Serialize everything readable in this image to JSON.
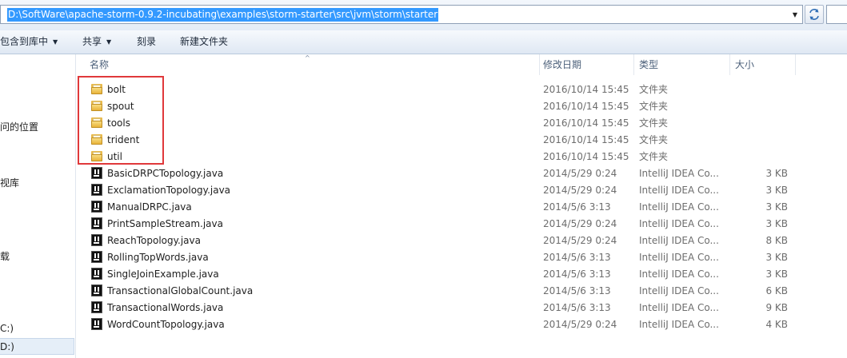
{
  "address_bar": {
    "path": "D:\\SoftWare\\apache-storm-0.9.2-incubating\\examples\\storm-starter\\src\\jvm\\storm\\starter",
    "dropdown_icon": "chevron-down-icon",
    "refresh_icon": "refresh-icon"
  },
  "toolbar": {
    "include_in_library": "包含到库中",
    "share": "共享",
    "burn": "刻录",
    "new_folder": "新建文件夹"
  },
  "nav": {
    "items": [
      "问的位置",
      "视库",
      "载",
      "C:)",
      "D:)"
    ]
  },
  "columns": {
    "name": "名称",
    "date": "修改日期",
    "type": "类型",
    "size": "大小"
  },
  "files": [
    {
      "name": "bolt",
      "date": "2016/10/14 15:45",
      "type": "文件夹",
      "size": "",
      "icon": "folder-icon"
    },
    {
      "name": "spout",
      "date": "2016/10/14 15:45",
      "type": "文件夹",
      "size": "",
      "icon": "folder-icon"
    },
    {
      "name": "tools",
      "date": "2016/10/14 15:45",
      "type": "文件夹",
      "size": "",
      "icon": "folder-icon"
    },
    {
      "name": "trident",
      "date": "2016/10/14 15:45",
      "type": "文件夹",
      "size": "",
      "icon": "folder-icon"
    },
    {
      "name": "util",
      "date": "2016/10/14 15:45",
      "type": "文件夹",
      "size": "",
      "icon": "folder-icon"
    },
    {
      "name": "BasicDRPCTopology.java",
      "date": "2014/5/29 0:24",
      "type": "IntelliJ IDEA Co...",
      "size": "3 KB",
      "icon": "intellij-file-icon"
    },
    {
      "name": "ExclamationTopology.java",
      "date": "2014/5/29 0:24",
      "type": "IntelliJ IDEA Co...",
      "size": "3 KB",
      "icon": "intellij-file-icon"
    },
    {
      "name": "ManualDRPC.java",
      "date": "2014/5/6 3:13",
      "type": "IntelliJ IDEA Co...",
      "size": "3 KB",
      "icon": "intellij-file-icon"
    },
    {
      "name": "PrintSampleStream.java",
      "date": "2014/5/29 0:24",
      "type": "IntelliJ IDEA Co...",
      "size": "3 KB",
      "icon": "intellij-file-icon"
    },
    {
      "name": "ReachTopology.java",
      "date": "2014/5/29 0:24",
      "type": "IntelliJ IDEA Co...",
      "size": "8 KB",
      "icon": "intellij-file-icon"
    },
    {
      "name": "RollingTopWords.java",
      "date": "2014/5/6 3:13",
      "type": "IntelliJ IDEA Co...",
      "size": "3 KB",
      "icon": "intellij-file-icon"
    },
    {
      "name": "SingleJoinExample.java",
      "date": "2014/5/6 3:13",
      "type": "IntelliJ IDEA Co...",
      "size": "3 KB",
      "icon": "intellij-file-icon"
    },
    {
      "name": "TransactionalGlobalCount.java",
      "date": "2014/5/6 3:13",
      "type": "IntelliJ IDEA Co...",
      "size": "6 KB",
      "icon": "intellij-file-icon"
    },
    {
      "name": "TransactionalWords.java",
      "date": "2014/5/6 3:13",
      "type": "IntelliJ IDEA Co...",
      "size": "9 KB",
      "icon": "intellij-file-icon"
    },
    {
      "name": "WordCountTopology.java",
      "date": "2014/5/29 0:24",
      "type": "IntelliJ IDEA Co...",
      "size": "4 KB",
      "icon": "intellij-file-icon"
    }
  ],
  "colors": {
    "selection": "#3399ff",
    "highlight_box": "#e0393b",
    "folder": "#e9b949"
  }
}
